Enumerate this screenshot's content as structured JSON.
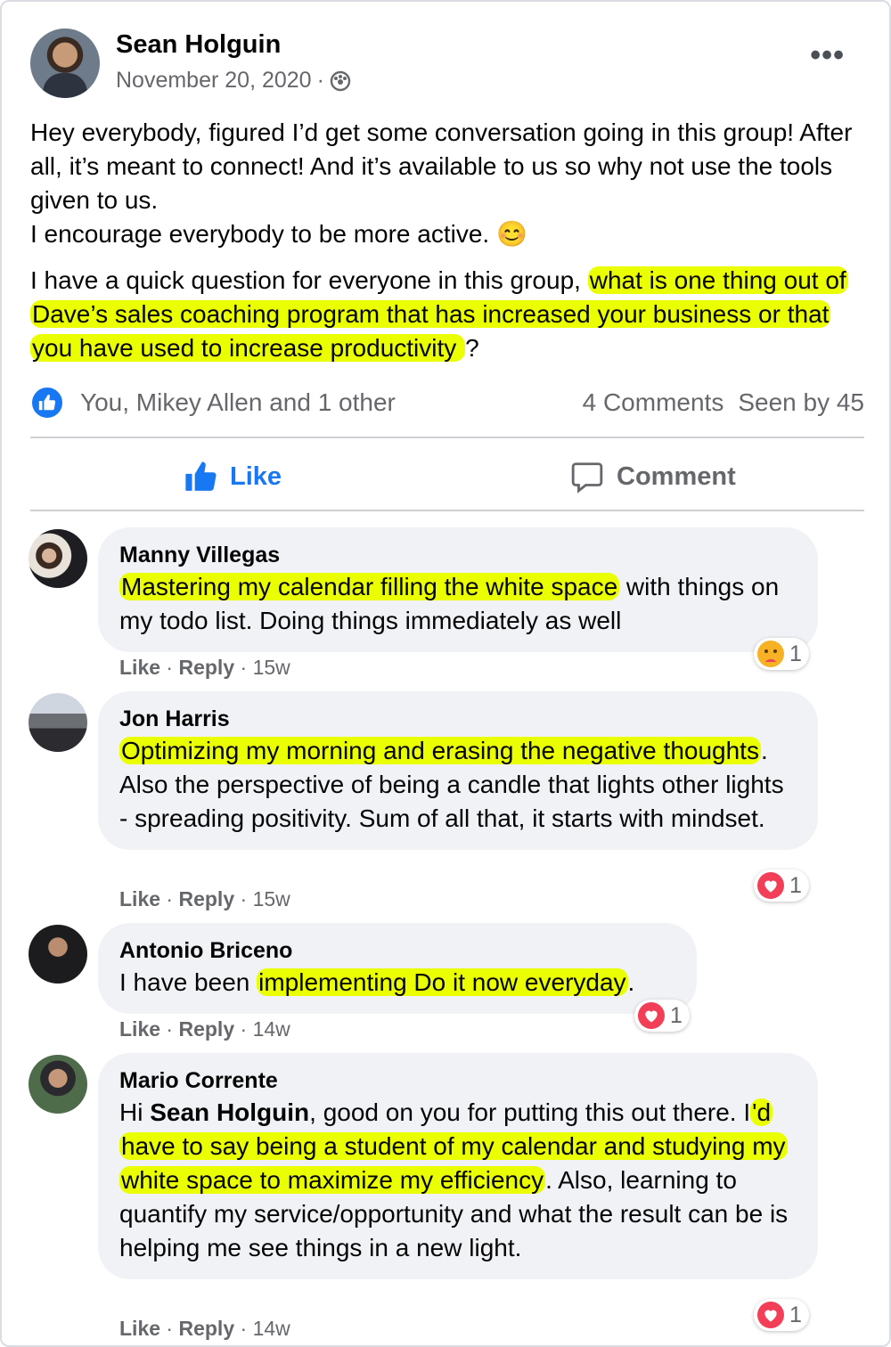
{
  "post": {
    "author": "Sean Holguin",
    "date": "November 20, 2020",
    "separator": "·",
    "more_label": "•••",
    "text_line1": "Hey everybody, figured I’d get some conversation going in this group! After all, it’s meant to connect! And it’s available to us so why not use the tools given to us.",
    "text_line2": "I encourage everybody to be more active. 😊",
    "text_q_plain": "I have a quick question for everyone in this group, ",
    "text_q_highlight": "what is one thing out of Dave’s sales coaching program that has increased your business or that you have used to increase productivity  ",
    "text_q_end": "?"
  },
  "reactions": {
    "names": "You, Mikey Allen and 1 other",
    "comments_count": "4 Comments",
    "seen_by": "Seen by 45"
  },
  "actions": {
    "like_label": "Like",
    "comment_label": "Comment"
  },
  "comments": [
    {
      "name": "Manny Villegas",
      "highlight": "Mastering my calendar filling the white space",
      "rest": " with things on my todo list. Doing things immediately as well",
      "like": "Like",
      "reply": "Reply",
      "time": "15w",
      "reaction_count": "1",
      "reaction_icon": "care-emoji-icon"
    },
    {
      "name": "Jon Harris",
      "highlight": "Optimizing my morning and erasing the negative thoughts",
      "rest": ". Also the perspective of being a candle that lights other lights - spreading positivity. Sum of all that, it starts with mindset.",
      "like": "Like",
      "reply": "Reply",
      "time": "15w",
      "reaction_count": "1",
      "reaction_icon": "love-heart-icon"
    },
    {
      "name": "Antonio Briceno",
      "pre": "I have been ",
      "highlight": "implementing Do it now everyday",
      "rest": ".",
      "like": "Like",
      "reply": "Reply",
      "time": "14w",
      "reaction_count": "1",
      "reaction_icon": "love-heart-icon"
    },
    {
      "name": "Mario Corrente",
      "pre": "Hi ",
      "mention": "Sean Holguin",
      "mid": ", good on you for putting this out there. I",
      "highlight": "'d have to say being a student of my calendar and studying my white space to maximize my efficiency",
      "rest": ". Also, learning to quantify my service/opportunity and what the result can be is helping me see things in a new light.",
      "like": "Like",
      "reply": "Reply",
      "time": "14w",
      "reaction_count": "1",
      "reaction_icon": "love-heart-icon"
    }
  ],
  "colors": {
    "highlight": "#eaff00",
    "facebook_blue": "#1877f2",
    "love_red": "#f33e58",
    "bubble_bg": "#f0f2f5",
    "secondary_text": "#65676b"
  }
}
